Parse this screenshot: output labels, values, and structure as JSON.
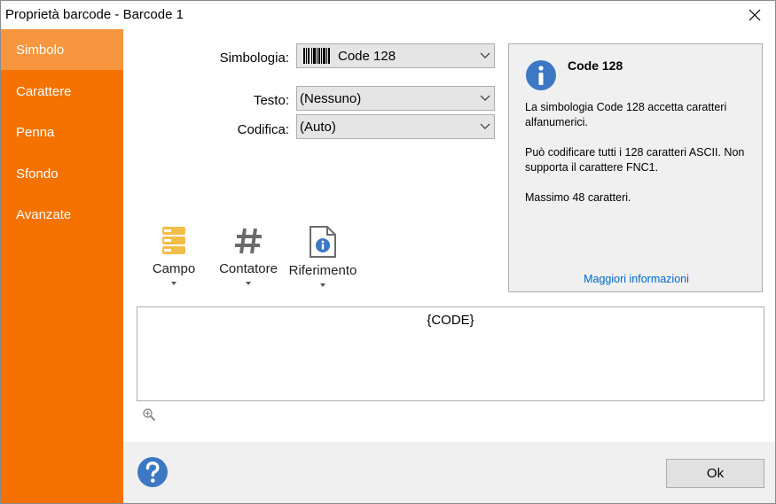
{
  "window": {
    "title": "Proprietà barcode - Barcode 1"
  },
  "sidebar": {
    "items": [
      {
        "label": "Simbolo",
        "active": true
      },
      {
        "label": "Carattere",
        "active": false
      },
      {
        "label": "Penna",
        "active": false
      },
      {
        "label": "Sfondo",
        "active": false
      },
      {
        "label": "Avanzate",
        "active": false
      }
    ]
  },
  "form": {
    "symbology_label": "Simbologia:",
    "symbology_value": "Code 128",
    "text_label": "Testo:",
    "text_value": "(Nessuno)",
    "encoding_label": "Codifica:",
    "encoding_value": "(Auto)"
  },
  "info": {
    "title": "Code 128",
    "line1": "La simbologia Code 128 accetta caratteri alfanumerici.",
    "line2": "Può codificare tutti i 128 caratteri ASCII. Non supporta il carattere FNC1.",
    "line3": "Massimo 48 caratteri.",
    "link": "Maggiori informazioni"
  },
  "toolbar": {
    "field_label": "Campo",
    "counter_label": "Contatore",
    "reference_label": "Riferimento"
  },
  "editor": {
    "value": "{CODE}"
  },
  "footer": {
    "ok_label": "Ok"
  },
  "colors": {
    "sidebar_bg": "#f57200",
    "sidebar_active": "#f7963e",
    "info_icon": "#3c78c3",
    "link": "#0066cc",
    "field_icon": "#f2be4a"
  },
  "icons": {
    "close": "close-icon",
    "barcode": "barcode-icon",
    "info": "info-icon",
    "field": "database-field-icon",
    "counter": "hash-icon",
    "reference": "document-info-icon",
    "zoom": "zoom-in-icon",
    "help": "help-icon"
  }
}
